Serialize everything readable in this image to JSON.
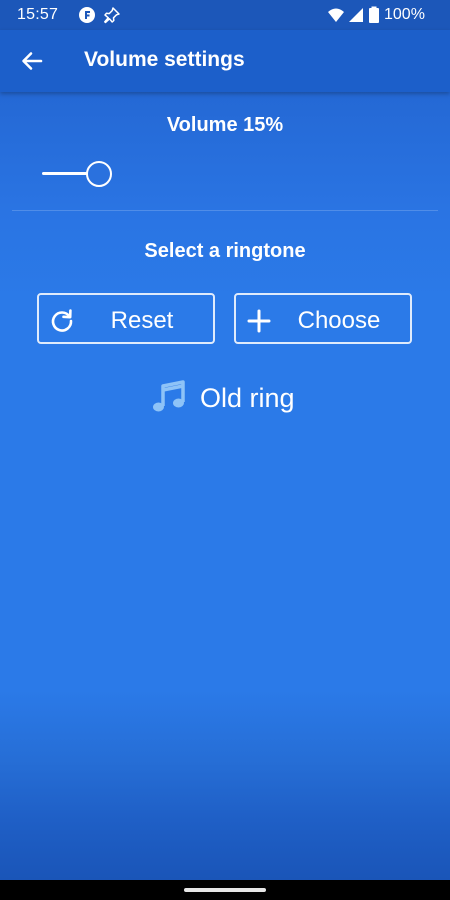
{
  "status_bar": {
    "time": "15:57",
    "battery_percent": "100%",
    "icons": [
      "notification-f-icon",
      "pin-icon",
      "wifi-icon",
      "signal-icon",
      "battery-icon"
    ]
  },
  "app_bar": {
    "title": "Volume settings",
    "back_icon": "arrow-left-icon"
  },
  "volume": {
    "label": "Volume 15%",
    "value_percent": 15
  },
  "ringtone": {
    "heading": "Select a ringtone",
    "reset_label": "Reset",
    "reset_icon": "refresh-icon",
    "choose_label": "Choose",
    "choose_icon": "plus-icon",
    "current_icon": "music-note-icon",
    "current_name": "Old ring"
  },
  "colors": {
    "primary": "#1c5fca",
    "background": "#2b7ae8",
    "music_icon": "#8ec3f7"
  }
}
